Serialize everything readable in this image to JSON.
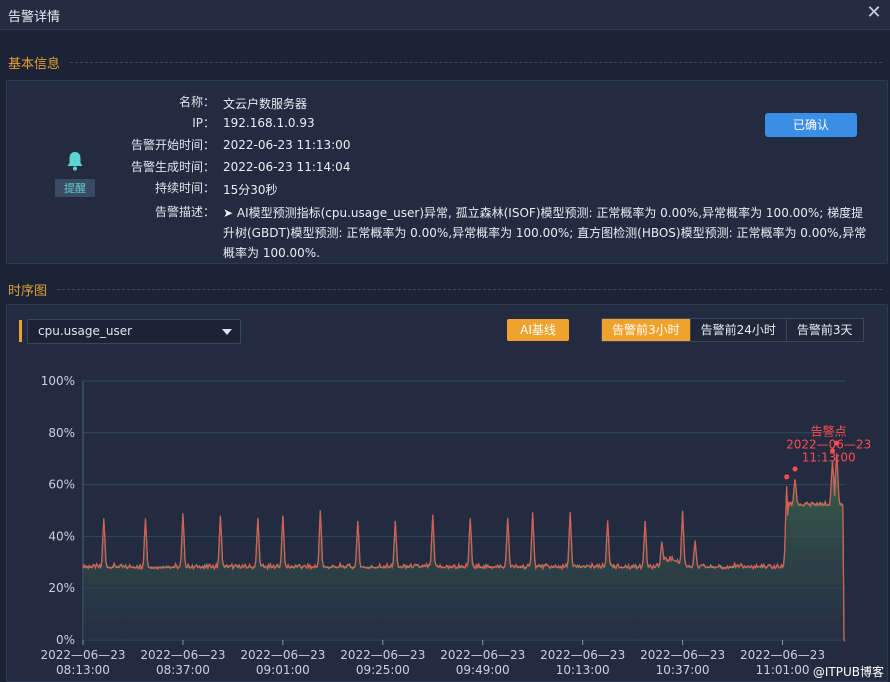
{
  "window": {
    "title": "告警详情"
  },
  "basic_info": {
    "section_title": "基本信息",
    "level_badge": "提醒",
    "fields": [
      {
        "label": "名称：",
        "value": "文云户数服务器"
      },
      {
        "label": "IP：",
        "value": "192.168.1.0.93"
      },
      {
        "label": "告警开始时间：",
        "value": "2022-06-23 11:13:00"
      },
      {
        "label": "告警生成时间：",
        "value": "2022-06-23 11:14:04"
      },
      {
        "label": "持续时间：",
        "value": "15分30秒"
      }
    ],
    "desc_label": "告警描述：",
    "desc_value": "➤ AI模型预测指标(cpu.usage_user)异常, 孤立森林(ISOF)模型预测: 正常概率为 0.00%,异常概率为 100.00%; 梯度提升树(GBDT)模型预测: 正常概率为 0.00%,异常概率为 100.00%; 直方图检测(HBOS)模型预测: 正常概率为 0.00%,异常概率为 100.00%.",
    "confirm_button": "已确认"
  },
  "timeseries": {
    "section_title": "时序图",
    "metric_selected": "cpu.usage_user",
    "ai_baseline_button": "AI基线",
    "ranges": [
      "告警前3小时",
      "告警前24小时",
      "告警前3天"
    ],
    "active_range": 0
  },
  "colors": {
    "accent": "#f0a32c",
    "primary": "#3a8ee6",
    "series_red": "#e05a55",
    "series_green": "#3fae6a",
    "alert": "#ff4d4f"
  },
  "chart_data": {
    "type": "line",
    "ylim": [
      0,
      100
    ],
    "ytick_labels": [
      "0%",
      "20%",
      "40%",
      "60%",
      "80%",
      "100%"
    ],
    "yticks": [
      0,
      20,
      40,
      60,
      80,
      100
    ],
    "xtick_labels": [
      [
        "2022—06—23",
        "08:13:00"
      ],
      [
        "2022—06—23",
        "08:37:00"
      ],
      [
        "2022—06—23",
        "09:01:00"
      ],
      [
        "2022—06—23",
        "09:25:00"
      ],
      [
        "2022—06—23",
        "09:49:00"
      ],
      [
        "2022—06—23",
        "10:13:00"
      ],
      [
        "2022—06—23",
        "10:37:00"
      ],
      [
        "2022—06—23",
        "11:01:00"
      ]
    ],
    "x_range_minutes": [
      0,
      183
    ],
    "xtick_minutes": [
      0,
      24,
      48,
      72,
      96,
      120,
      144,
      168
    ],
    "baseline": 28,
    "spikes": [
      {
        "t": 5,
        "v": 47
      },
      {
        "t": 15,
        "v": 47
      },
      {
        "t": 24,
        "v": 49
      },
      {
        "t": 33,
        "v": 48
      },
      {
        "t": 42,
        "v": 47
      },
      {
        "t": 48,
        "v": 48
      },
      {
        "t": 57,
        "v": 50
      },
      {
        "t": 66,
        "v": 46
      },
      {
        "t": 75,
        "v": 46
      },
      {
        "t": 84,
        "v": 48
      },
      {
        "t": 93,
        "v": 47
      },
      {
        "t": 102,
        "v": 47
      },
      {
        "t": 108,
        "v": 49
      },
      {
        "t": 117,
        "v": 49
      },
      {
        "t": 126,
        "v": 46
      },
      {
        "t": 135,
        "v": 46
      },
      {
        "t": 139,
        "v": 38
      },
      {
        "t": 144,
        "v": 50
      },
      {
        "t": 147,
        "v": 38
      }
    ],
    "step": {
      "t_start": 169.5,
      "level": 52
    },
    "alert_points": [
      {
        "t": 169,
        "v": 63
      },
      {
        "t": 171,
        "v": 66
      },
      {
        "t": 180,
        "v": 73
      },
      {
        "t": 181,
        "v": 76
      }
    ],
    "annotation": [
      "告警点",
      "2022—06—23",
      "11:13:00"
    ]
  },
  "watermark": "@ITPUB博客"
}
